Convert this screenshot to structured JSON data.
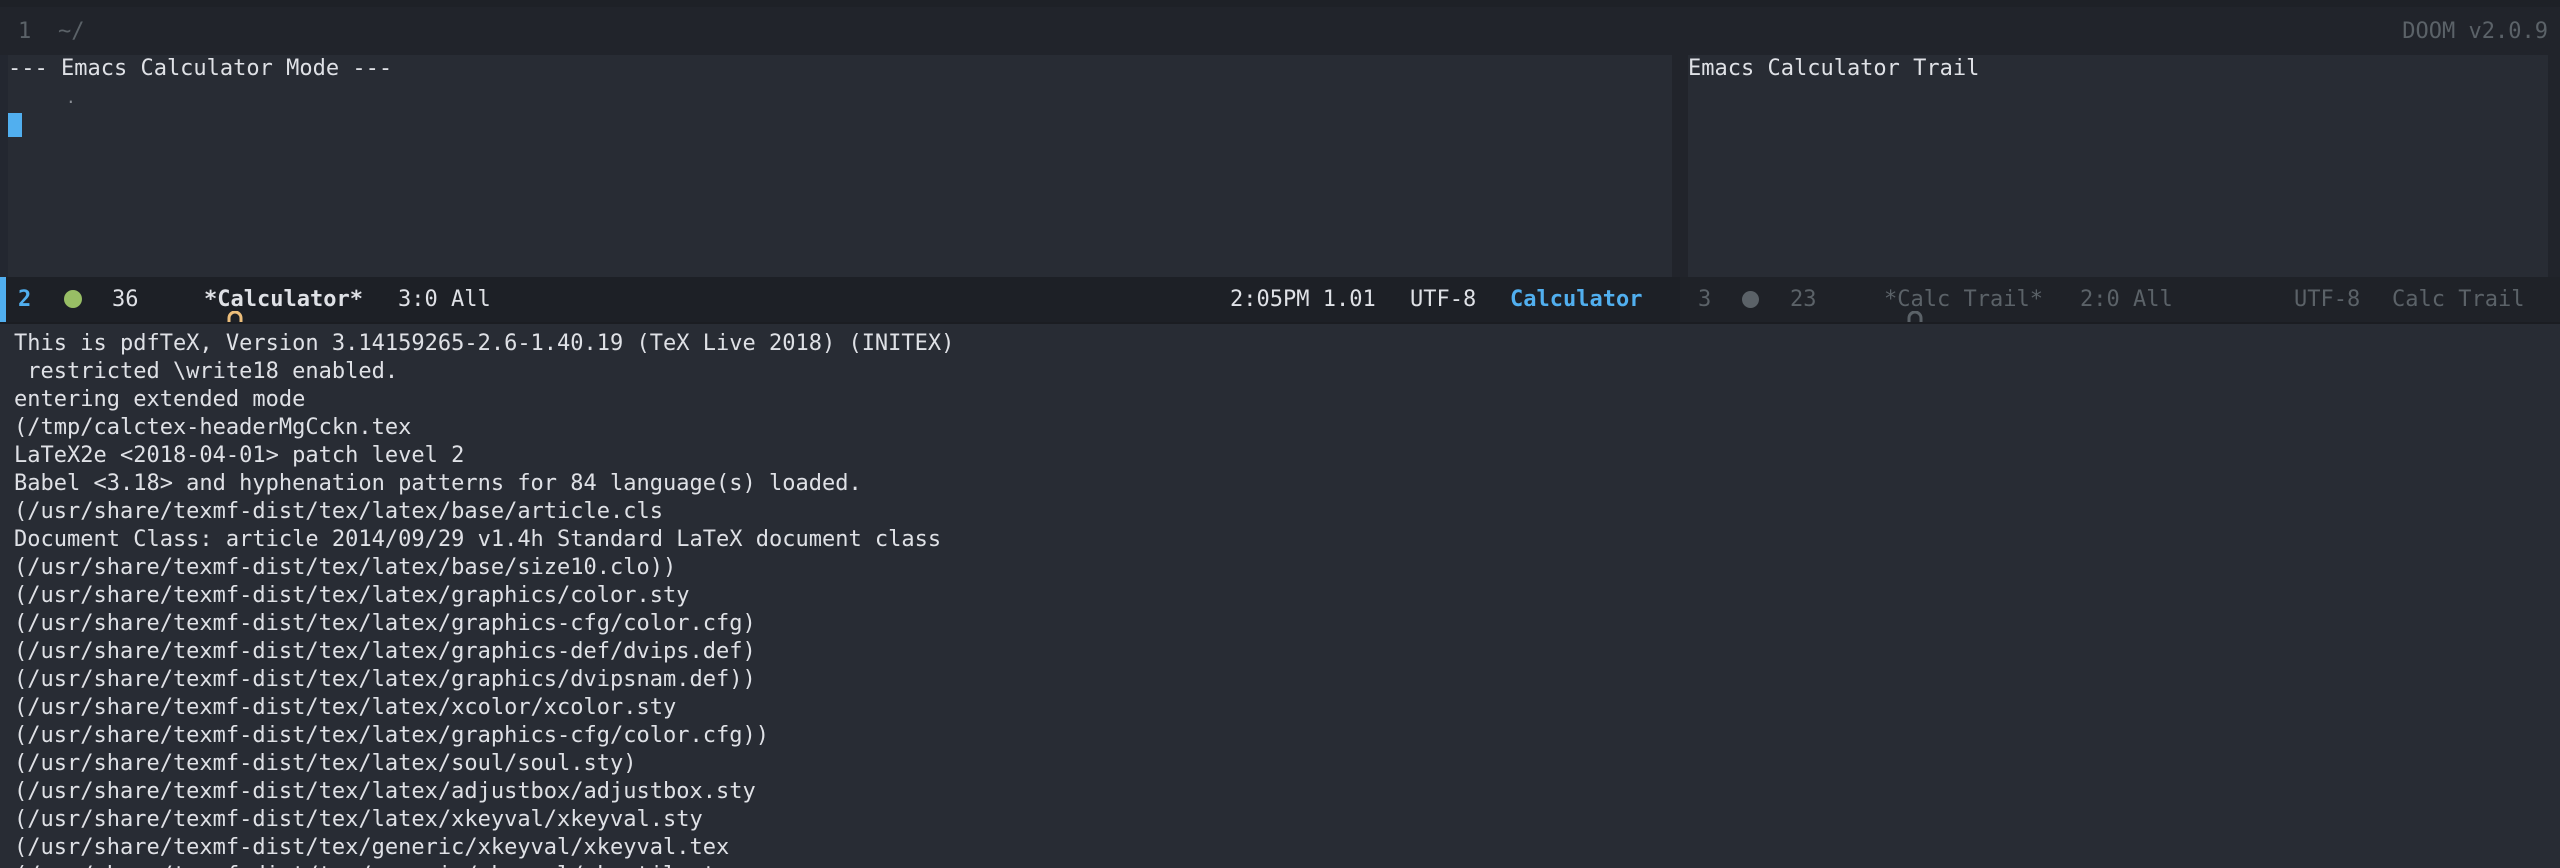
{
  "header": {
    "line_number": "1",
    "path": "~/",
    "doom_version": "DOOM v2.0.9"
  },
  "calculator": {
    "title": "--- Emacs Calculator Mode ---",
    "stack_dot": "."
  },
  "trail": {
    "title": "Emacs Calculator Trail"
  },
  "modeline_active": {
    "window_number": "2",
    "count": "36",
    "buffer_name": "*Calculator*",
    "position": "3:0 All",
    "time_load": "2:05PM 1.01",
    "encoding": "UTF-8",
    "major_mode": "Calculator"
  },
  "modeline_inactive": {
    "window_number": "3",
    "count": "23",
    "buffer_name": "*Calc Trail*",
    "position": "2:0 All",
    "encoding": "UTF-8",
    "major_mode": "Calc Trail"
  },
  "tex_output": [
    "This is pdfTeX, Version 3.14159265-2.6-1.40.19 (TeX Live 2018) (INITEX)",
    " restricted \\write18 enabled.",
    "entering extended mode",
    "(/tmp/calctex-headerMgCckn.tex",
    "LaTeX2e <2018-04-01> patch level 2",
    "Babel <3.18> and hyphenation patterns for 84 language(s) loaded.",
    "(/usr/share/texmf-dist/tex/latex/base/article.cls",
    "Document Class: article 2014/09/29 v1.4h Standard LaTeX document class",
    "(/usr/share/texmf-dist/tex/latex/base/size10.clo))",
    "(/usr/share/texmf-dist/tex/latex/graphics/color.sty",
    "(/usr/share/texmf-dist/tex/latex/graphics-cfg/color.cfg)",
    "(/usr/share/texmf-dist/tex/latex/graphics-def/dvips.def)",
    "(/usr/share/texmf-dist/tex/latex/graphics/dvipsnam.def))",
    "(/usr/share/texmf-dist/tex/latex/xcolor/xcolor.sty",
    "(/usr/share/texmf-dist/tex/latex/graphics-cfg/color.cfg))",
    "(/usr/share/texmf-dist/tex/latex/soul/soul.sty)",
    "(/usr/share/texmf-dist/tex/latex/adjustbox/adjustbox.sty",
    "(/usr/share/texmf-dist/tex/latex/xkeyval/xkeyval.sty",
    "(/usr/share/texmf-dist/tex/generic/xkeyval/xkeyval.tex",
    "(/usr/share/texmf-dist/tex/generic/xkeyval/xkvutils.tex"
  ],
  "colors": {
    "background": "#282c34",
    "accent": "#51afef",
    "modified_dot": "#98be65",
    "inactive_text": "#5b6268",
    "lock": "#ecbe7b"
  },
  "icons": {
    "active_status": "circle-icon",
    "active_lock": "lock-icon",
    "inactive_status": "circle-icon",
    "inactive_lock": "lock-icon"
  }
}
